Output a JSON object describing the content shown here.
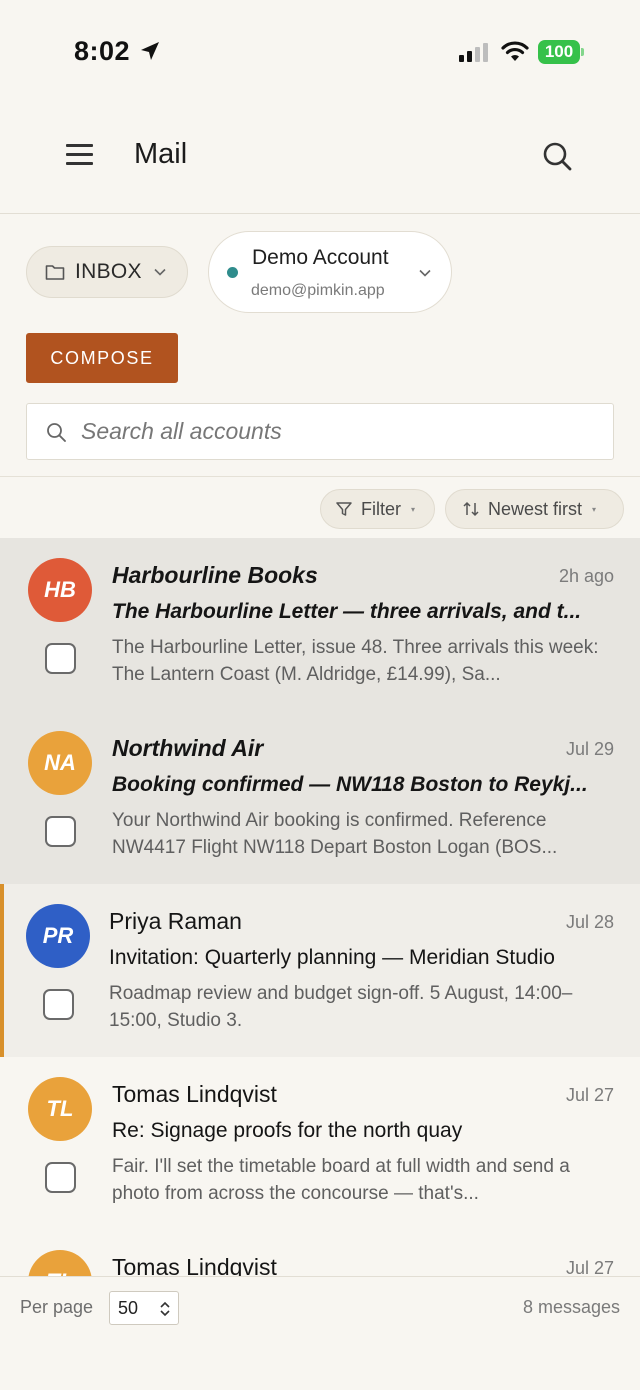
{
  "status_bar": {
    "time": "8:02",
    "battery": "100"
  },
  "header": {
    "title": "Mail"
  },
  "toolbar": {
    "folder_label": "INBOX",
    "account_name": "Demo Account",
    "account_email": "demo@pimkin.app",
    "compose_label": "COMPOSE",
    "search_placeholder": "Search all accounts",
    "filter_label": "Filter",
    "sort_label": "Newest first"
  },
  "colors": {
    "accent": "#b1531f",
    "selected_bar": "#d8902b",
    "account_dot": "#2f8c8c"
  },
  "messages": [
    {
      "initials": "HB",
      "avatar_color": "#df5a38",
      "sender": "Harbourline Books",
      "time": "2h ago",
      "subject": "The Harbourline Letter — three arrivals, and t...",
      "preview": "The Harbourline Letter, issue 48. Three arrivals this week: The Lantern Coast (M. Aldridge, £14.99), Sa...",
      "state": "unread"
    },
    {
      "initials": "NA",
      "avatar_color": "#e9a23b",
      "sender": "Northwind Air",
      "time": "Jul 29",
      "subject": "Booking confirmed — NW118 Boston to Reykj...",
      "preview": "Your Northwind Air booking is confirmed. Reference NW4417 Flight NW118 Depart Boston Logan (BOS...",
      "state": "unread"
    },
    {
      "initials": "PR",
      "avatar_color": "#2f5fc6",
      "sender": "Priya Raman",
      "time": "Jul 28",
      "subject": "Invitation: Quarterly planning — Meridian Studio",
      "preview": "Roadmap review and budget sign-off. 5 August, 14:00–15:00, Studio 3.",
      "state": "selected"
    },
    {
      "initials": "TL",
      "avatar_color": "#e9a23b",
      "sender": "Tomas Lindqvist",
      "time": "Jul 27",
      "subject": "Re: Signage proofs for the north quay",
      "preview": "Fair. I'll set the timetable board at full width and send a photo from across the concourse — that's...",
      "state": "normal"
    },
    {
      "initials": "TL",
      "avatar_color": "#e9a23b",
      "sender": "Tomas Lindqvist",
      "time": "Jul 27",
      "subject": "",
      "preview": "",
      "state": "normal"
    }
  ],
  "footer": {
    "per_page_label": "Per page",
    "per_page_value": "50",
    "count_label": "8 messages"
  }
}
